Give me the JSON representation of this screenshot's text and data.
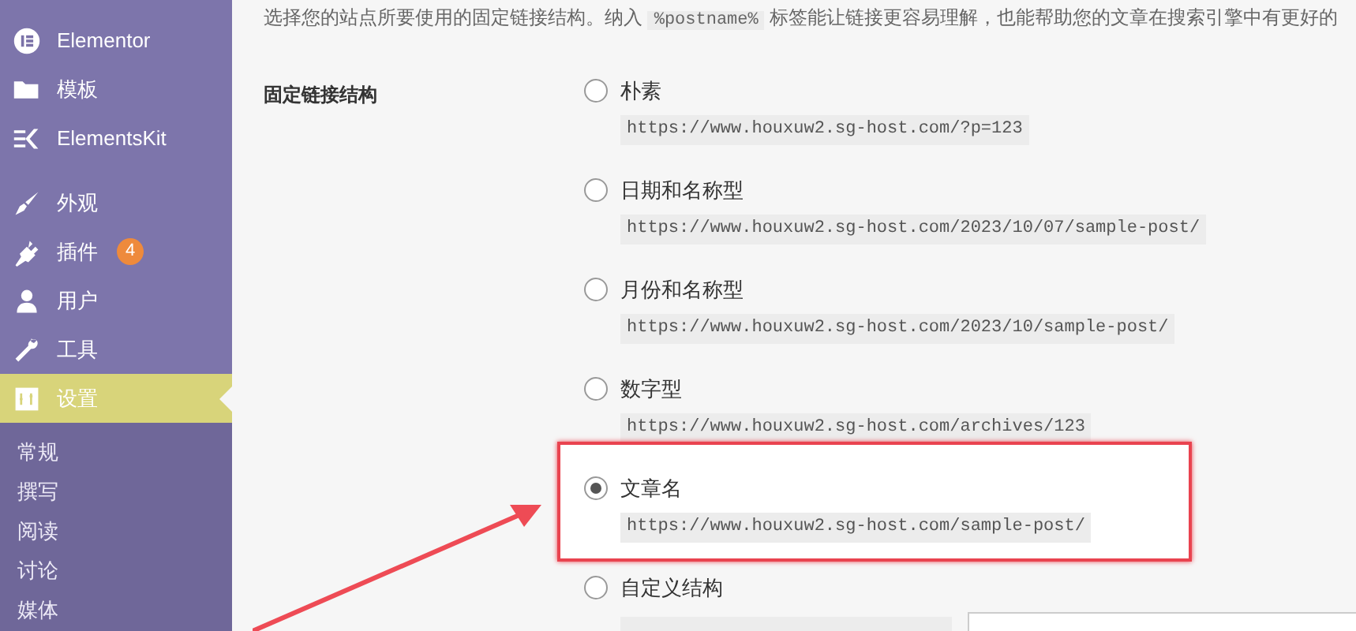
{
  "sidebar": {
    "items": [
      {
        "label": "Elementor",
        "kind": "elementor",
        "selected": false
      },
      {
        "label": "模板",
        "kind": "folder",
        "selected": false
      },
      {
        "label": "ElementsKit",
        "kind": "ek",
        "selected": false
      },
      {
        "label": "外观",
        "kind": "brush",
        "selected": false
      },
      {
        "label": "插件",
        "kind": "plug",
        "selected": false,
        "badge": "4"
      },
      {
        "label": "用户",
        "kind": "user",
        "selected": false
      },
      {
        "label": "工具",
        "kind": "wrench",
        "selected": false
      },
      {
        "label": "设置",
        "kind": "settings",
        "selected": true
      }
    ],
    "submenu": [
      "常规",
      "撰写",
      "阅读",
      "讨论",
      "媒体"
    ]
  },
  "intro": {
    "before": "选择您的站点所要使用的固定链接结构。纳入",
    "code": "%postname%",
    "after": "标签能让链接更容易理解，也能帮助您的文章在搜索引擎中有更好的"
  },
  "permalink": {
    "label": "固定链接结构",
    "options": [
      {
        "label": "朴素",
        "example": "https://www.houxuw2.sg-host.com/?p=123",
        "selected": false,
        "highlighted": false
      },
      {
        "label": "日期和名称型",
        "example": "https://www.houxuw2.sg-host.com/2023/10/07/sample-post/",
        "selected": false,
        "highlighted": false
      },
      {
        "label": "月份和名称型",
        "example": "https://www.houxuw2.sg-host.com/2023/10/sample-post/",
        "selected": false,
        "highlighted": false
      },
      {
        "label": "数字型",
        "example": "https://www.houxuw2.sg-host.com/archives/123",
        "selected": false,
        "highlighted": false
      },
      {
        "label": "文章名",
        "example": "https://www.houxuw2.sg-host.com/sample-post/",
        "selected": true,
        "highlighted": true
      },
      {
        "label": "自定义结构",
        "kind": "custom",
        "selected": false,
        "highlighted": false
      }
    ]
  }
}
